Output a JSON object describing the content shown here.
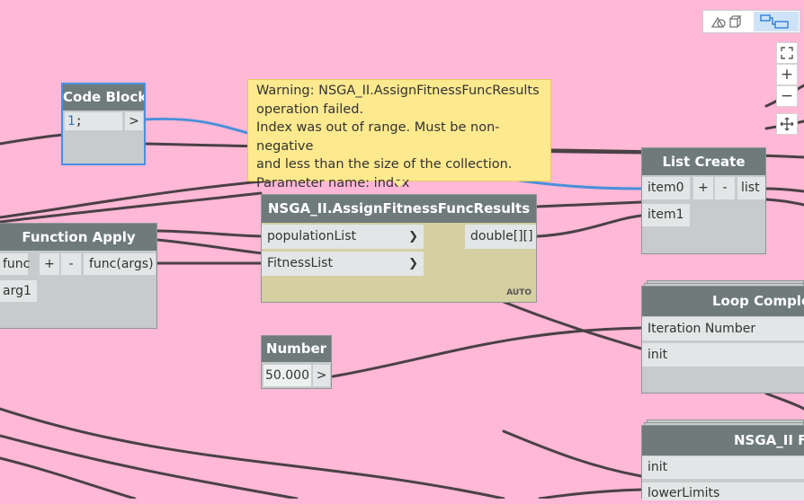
{
  "nodes": {
    "code_block": {
      "title": "Code Block",
      "code_value": "1",
      "code_suffix": ";",
      "output_arrow": ">"
    },
    "function_apply": {
      "title": "Function Apply",
      "input_func": "func",
      "plus": "+",
      "minus": "-",
      "output": "func(args)",
      "input_arg1": "arg1"
    },
    "assign_fitness": {
      "title": "NSGA_II.AssignFitnessFuncResults",
      "input_population": "populationList",
      "input_fitness": "FitnessList",
      "output": "double[][]",
      "lacing": "AUTO",
      "chevron": "❯"
    },
    "list_create": {
      "title": "List Create",
      "input_item0": "item0",
      "input_item1": "item1",
      "plus": "+",
      "minus": "-",
      "output": "list"
    },
    "number": {
      "title": "Number",
      "value": "50.000",
      "output_arrow": ">"
    },
    "loop_completion": {
      "title": "Loop Complet",
      "input_iteration": "Iteration Number",
      "input_init": "init"
    },
    "nsga_func": {
      "title": "NSGA_II Fu",
      "input_init": "init",
      "input_lower": "lowerLimits"
    }
  },
  "warning": {
    "line1": "Warning: NSGA_II.AssignFitnessFuncResults",
    "line2": "operation failed.",
    "line3": "Index was out of range. Must be non-negative",
    "line4": "and less than the size of the collection.",
    "line5": "Parameter name: index"
  },
  "controls": {
    "zoom_in": "+",
    "zoom_out": "−"
  },
  "colors": {
    "canvas": "#ffb8d6",
    "node_header": "#6f7b7b",
    "wire": "#4a4145",
    "wire_selected": "#4a90d9",
    "selection_border": "#4a8fe0",
    "warning_bg": "#fde98e",
    "function_node_body": "#d5cfa2"
  }
}
